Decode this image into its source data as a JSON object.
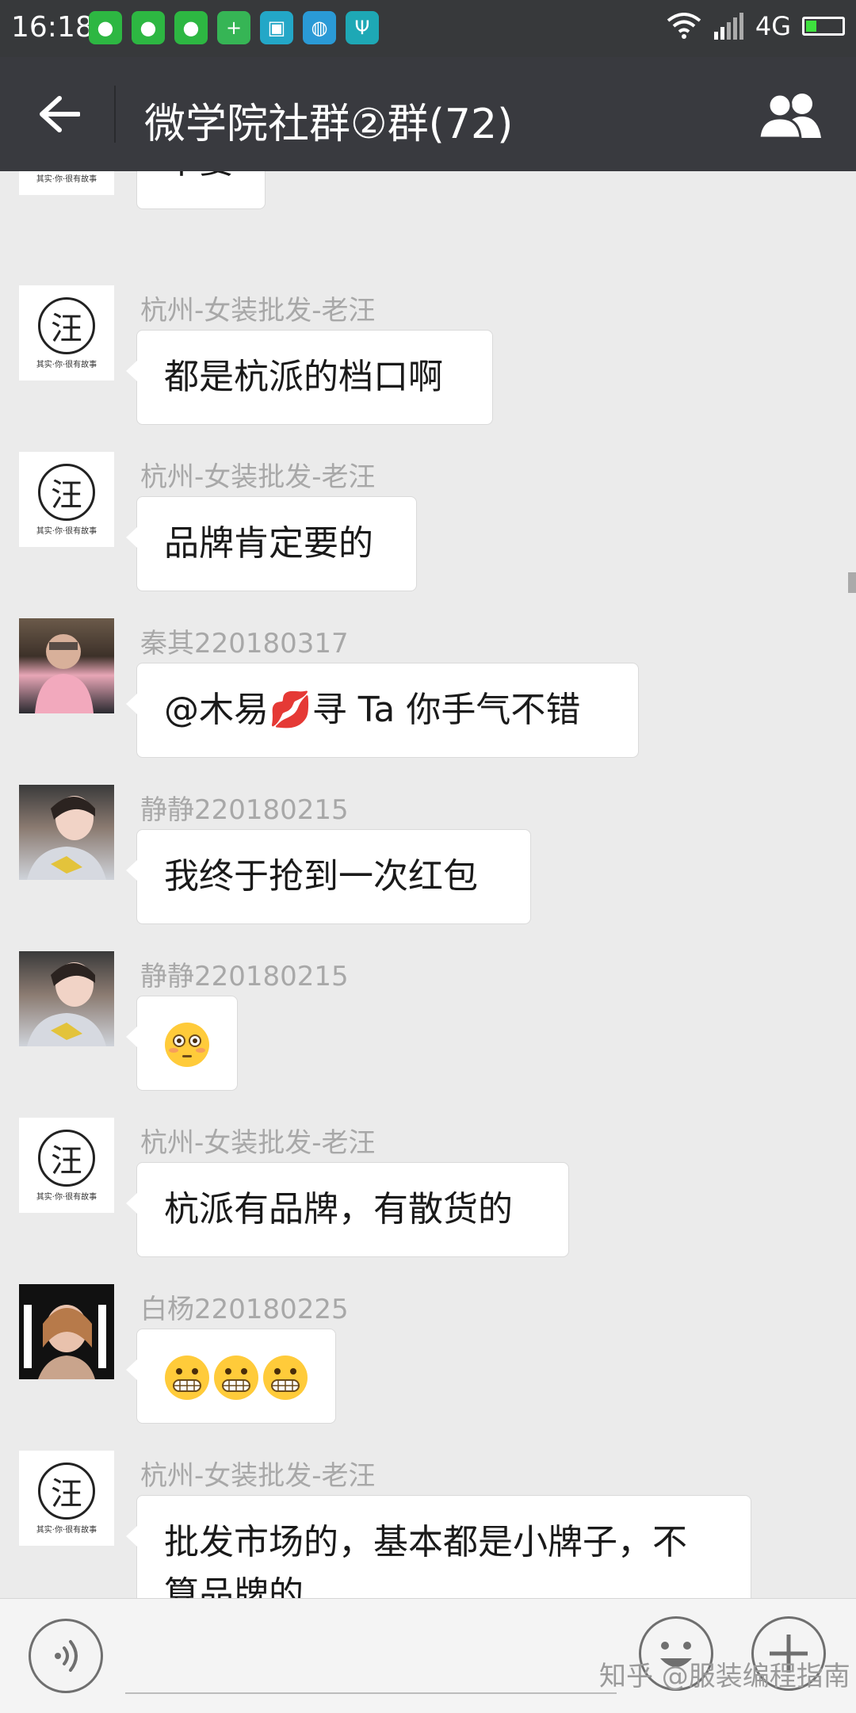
{
  "status_bar": {
    "time": "16:18",
    "network": "4G",
    "battery_level": 0.3
  },
  "nav": {
    "back_icon": "arrow-left-icon",
    "title": "微学院社群②群(72)",
    "members_icon": "group-members-icon"
  },
  "logo_avatar": {
    "char": "汪",
    "motto": "其实·你·很有故事"
  },
  "messages": [
    {
      "sender": "",
      "text": "不要"
    },
    {
      "sender": "杭州-女装批发-老汪",
      "text": "都是杭派的档口啊"
    },
    {
      "sender": "杭州-女装批发-老汪",
      "text": "品牌肯定要的"
    },
    {
      "sender": "秦其220180317",
      "text_before": "@木易",
      "emoji": "💋",
      "text_after": "寻 Ta  你手气不错"
    },
    {
      "sender": "静静220180215",
      "text": "我终于抢到一次红包"
    },
    {
      "sender": "静静220180215",
      "emoji": "flushed-face"
    },
    {
      "sender": "杭州-女装批发-老汪",
      "text": "杭派有品牌，有散货的"
    },
    {
      "sender": "白杨220180225",
      "emoji": "grimacing-face ×3"
    },
    {
      "sender": "杭州-女装批发-老汪",
      "text": "批发市场的，基本都是小牌子，不",
      "text_line2": "算品牌的"
    }
  ],
  "input_bar": {
    "voice_icon": "voice-icon",
    "emoji_icon": "emoji-icon",
    "plus_icon": "plus-icon"
  },
  "watermark": "知乎 @服装编程指南",
  "colors": {
    "nav_bg": "#393a3f",
    "status_bg": "#37393b",
    "chat_bg": "#ebebeb",
    "bubble_bg": "#ffffff",
    "sender_text": "#a8a8a8",
    "battery": "#3ee03e"
  }
}
